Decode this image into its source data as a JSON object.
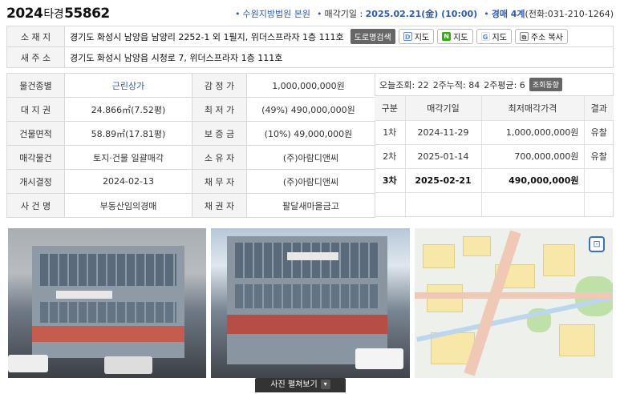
{
  "header": {
    "case_year": "2024",
    "case_kind": "타경",
    "case_num": "55862",
    "court": "수원지방법원 본원",
    "sale_date_label": "매각기일 :",
    "sale_date": "2025.02.21(金) (10:00)",
    "division": "경매 4계",
    "phone": "(전화:031-210-1264)"
  },
  "address": {
    "label": "소 재 지",
    "value": "경기도 화성시 남양읍 남양리 2252-1 외 1필지, 위더스프라자 1층 111호",
    "road_search": "도로명검색",
    "map_daum": "지도",
    "map_naver": "지도",
    "map_google": "지도",
    "copy": "주소 복사"
  },
  "new_address": {
    "label": "새 주 소",
    "value": "경기도 화성시 남양읍 시청로 7, 위더스프라자 1층 111호"
  },
  "details": [
    {
      "l1": "물건종별",
      "v1": "근린상가",
      "l2": "감 정 가",
      "v2": "1,000,000,000원"
    },
    {
      "l1": "대 지 권",
      "v1": "24.866㎡(7.52평)",
      "l2": "최 저 가",
      "v2": "(49%) 490,000,000원"
    },
    {
      "l1": "건물면적",
      "v1": "58.89㎡(17.81평)",
      "l2": "보 증 금",
      "v2": "(10%) 49,000,000원"
    },
    {
      "l1": "매각물건",
      "v1": "토지·건물 일괄매각",
      "l2": "소 유 자",
      "v2": "(주)아람디앤씨"
    },
    {
      "l1": "개시결정",
      "v1": "2024-02-13",
      "l2": "채 무 자",
      "v2": "(주)아람디앤씨"
    },
    {
      "l1": "사 건 명",
      "v1": "부동산임의경매",
      "l2": "채 권 자",
      "v2": "팔달새마을금고"
    }
  ],
  "views": {
    "today": "오늘조회: 22",
    "two_week": "2주누적: 84",
    "two_week_avg": "2주평균: 6",
    "button": "조회동향"
  },
  "history": {
    "headers": [
      "구분",
      "매각기일",
      "최저매각가격",
      "결과"
    ],
    "rows": [
      {
        "round": "1차",
        "date": "2024-11-29",
        "price": "1,000,000,000원",
        "result": "유찰"
      },
      {
        "round": "2차",
        "date": "2025-01-14",
        "price": "700,000,000원",
        "result": "유찰"
      },
      {
        "round": "3차",
        "date": "2025-02-21",
        "price": "490,000,000원",
        "result": ""
      }
    ]
  },
  "photos": {
    "expand_label": "사진 펼쳐보기"
  },
  "colors": {
    "accent_blue": "#2b5bb5",
    "label_bg": "#f4f4f4",
    "border": "#d8d8d8"
  }
}
